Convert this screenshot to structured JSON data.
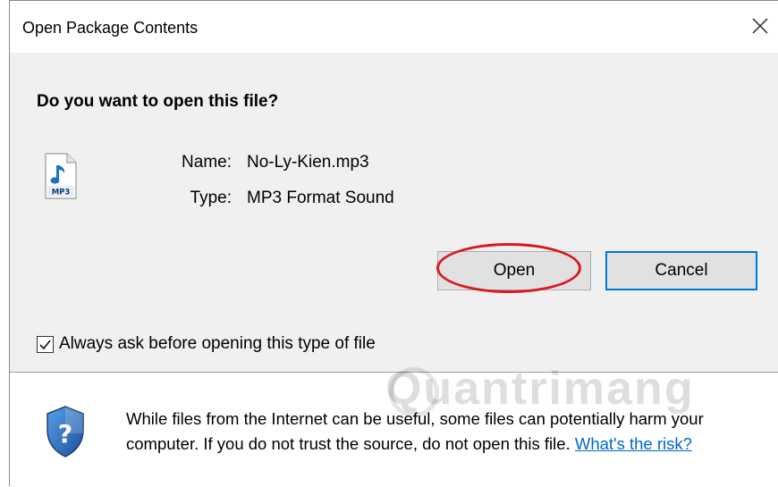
{
  "window": {
    "title": "Open Package Contents",
    "close_icon": "close-icon"
  },
  "prompt": {
    "question": "Do you want to open this file?"
  },
  "file": {
    "icon": "mp3-file-icon",
    "icon_text": "MP3",
    "name_label": "Name:",
    "name_value": "No-Ly-Kien.mp3",
    "type_label": "Type:",
    "type_value": "MP3 Format Sound"
  },
  "buttons": {
    "open_label": "Open",
    "cancel_label": "Cancel"
  },
  "checkbox": {
    "label": "Always ask before opening this type of file",
    "checked": true
  },
  "warning": {
    "icon": "shield-question-icon",
    "text": "While files from the Internet can be useful, some files can potentially harm your computer. If you do not trust the source, do not open this file.",
    "link_text": "What's the risk?"
  },
  "watermark": {
    "text": "Quantrimang"
  },
  "colors": {
    "highlight_ring": "#d9191c",
    "cancel_border": "#0078d7",
    "link": "#0066cc"
  }
}
